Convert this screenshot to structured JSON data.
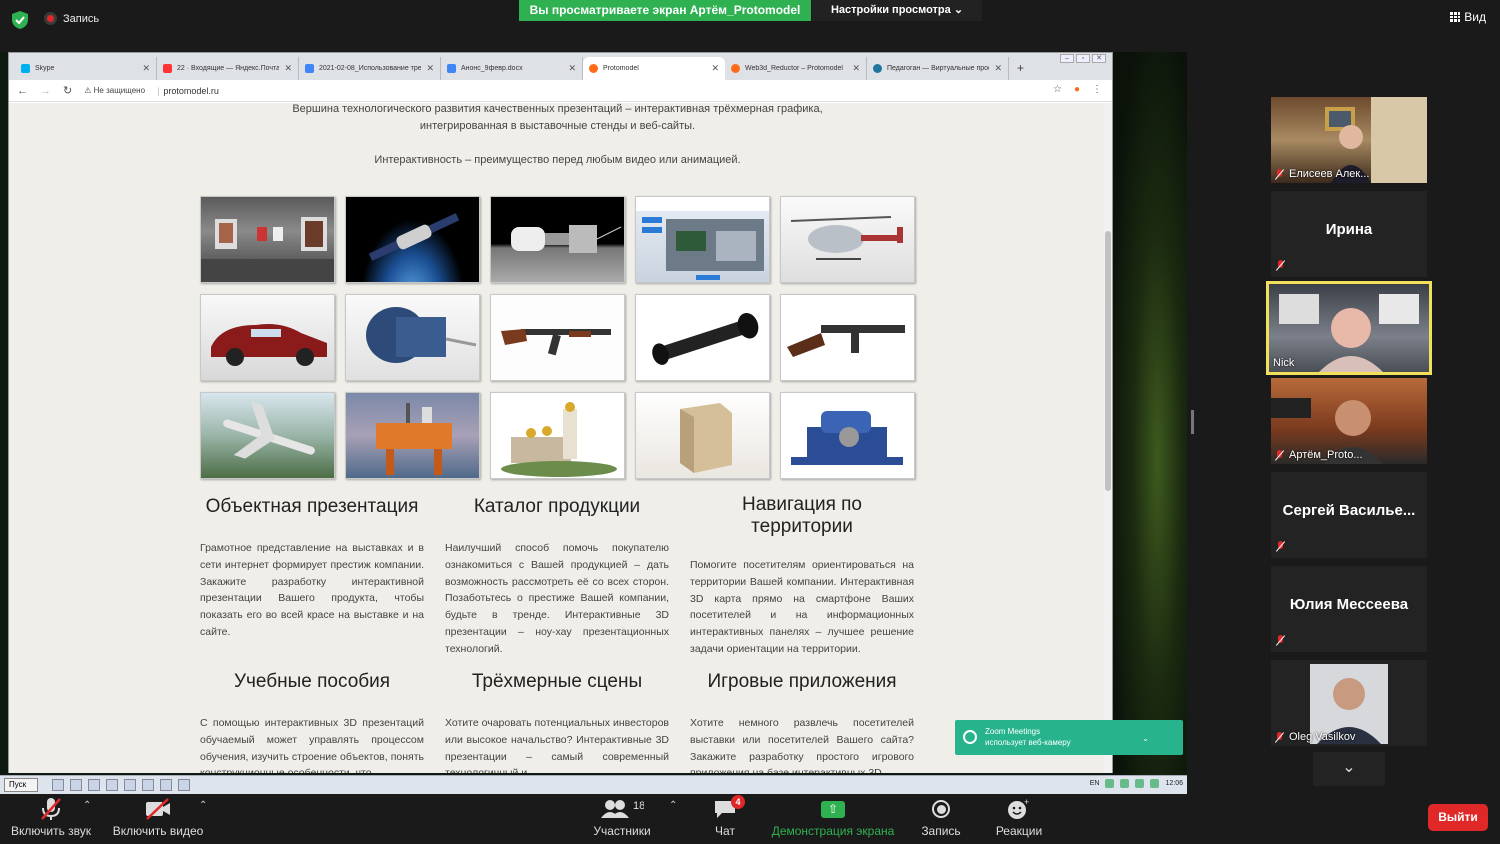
{
  "topbar": {
    "recording_label": "Запись",
    "share_banner": "Вы просматриваете экран Артём_Protomodel",
    "view_options": "Настройки просмотра ⌄",
    "view_label": "Вид"
  },
  "browser": {
    "tabs": [
      {
        "title": "Skype",
        "color": "#00aff0"
      },
      {
        "title": "22 · Входящие — Яндекс.Почта",
        "color": "#f33"
      },
      {
        "title": "2021-02-08_Использование трех",
        "color": "#4285f4"
      },
      {
        "title": "Анонс_9февр.docx",
        "color": "#4285f4"
      },
      {
        "title": "Protomodel",
        "color": "#ff6b1a"
      },
      {
        "title": "Web3d_Reductor – Protomodel",
        "color": "#ff6b1a"
      },
      {
        "title": "Педагоган — Виртуальные прое",
        "color": "#21759b"
      }
    ],
    "not_secure": "Не защищено",
    "url": "protomodel.ru"
  },
  "page": {
    "intro_line1": "Вершина технологического развития качественных презентаций – интерактивная трёхмерная графика,",
    "intro_line2": "интегрированная в выставочные стенды и веб-сайты.",
    "intro_line3": "Интерактивность – преимущество перед любым видео или анимацией.",
    "sections": [
      {
        "title": "Объектная презентация",
        "text": "Грамотное представление на выставках и в сети интернет формирует престиж компании. Закажите разработку интерактивной презентации Вашего продукта, чтобы показать его во всей красе на выставке и на сайте."
      },
      {
        "title": "Каталог продукции",
        "text": "Наилучший способ помочь покупателю ознакомиться с Вашей продукцией – дать возможность рассмотреть её со всех сторон. Позаботьтесь о престиже Вашей компании, будьте в тренде. Интерактивные 3D презентации – ноу-хау презентационных технологий."
      },
      {
        "title": "Навигация по территории",
        "text": "Помогите посетителям ориентироваться на территории Вашей компании. Интерактивная 3D карта прямо на смартфоне Ваших посетителей и на информационных интерактивных панелях – лучшее решение задачи ориентации на территории."
      },
      {
        "title": "Учебные пособия",
        "text": "С помощью интерактивных 3D презентаций обучаемый может управлять процессом обучения, изучить строение объектов, понять конструкционные особенности, что"
      },
      {
        "title": "Трёхмерные сцены",
        "text": "Хотите очаровать потенциальных инвесторов или высокое начальство? Интерактивные 3D презентации – самый современный технологичный и"
      },
      {
        "title": "Игровые приложения",
        "text": "Хотите немного развлечь посетителей выставки или посетителей Вашего сайта? Закажите разработку простого игрового приложения на базе интерактивных 3D"
      }
    ]
  },
  "taskbar": {
    "start": "Пуск",
    "lang": "EN",
    "time": "12:06"
  },
  "toast": {
    "line1": "Zoom Meetings",
    "line2": "использует веб-камеру",
    "chevron": "⌄"
  },
  "gallery": [
    {
      "name": "Елисеев Алек..."
    },
    {
      "name": "Ирина"
    },
    {
      "name": "Nick"
    },
    {
      "name": "Артём_Proto..."
    },
    {
      "name": "Сергей Василье..."
    },
    {
      "name": "Юлия Мессеева"
    },
    {
      "name": "Oleg Vasilkov"
    }
  ],
  "toolbar": {
    "unmute": "Включить звук",
    "start_video": "Включить видео",
    "participants": "Участники",
    "participants_count": "18",
    "chat": "Чат",
    "chat_badge": "4",
    "share": "Демонстрация экрана",
    "record": "Запись",
    "reactions": "Реакции",
    "leave": "Выйти"
  }
}
